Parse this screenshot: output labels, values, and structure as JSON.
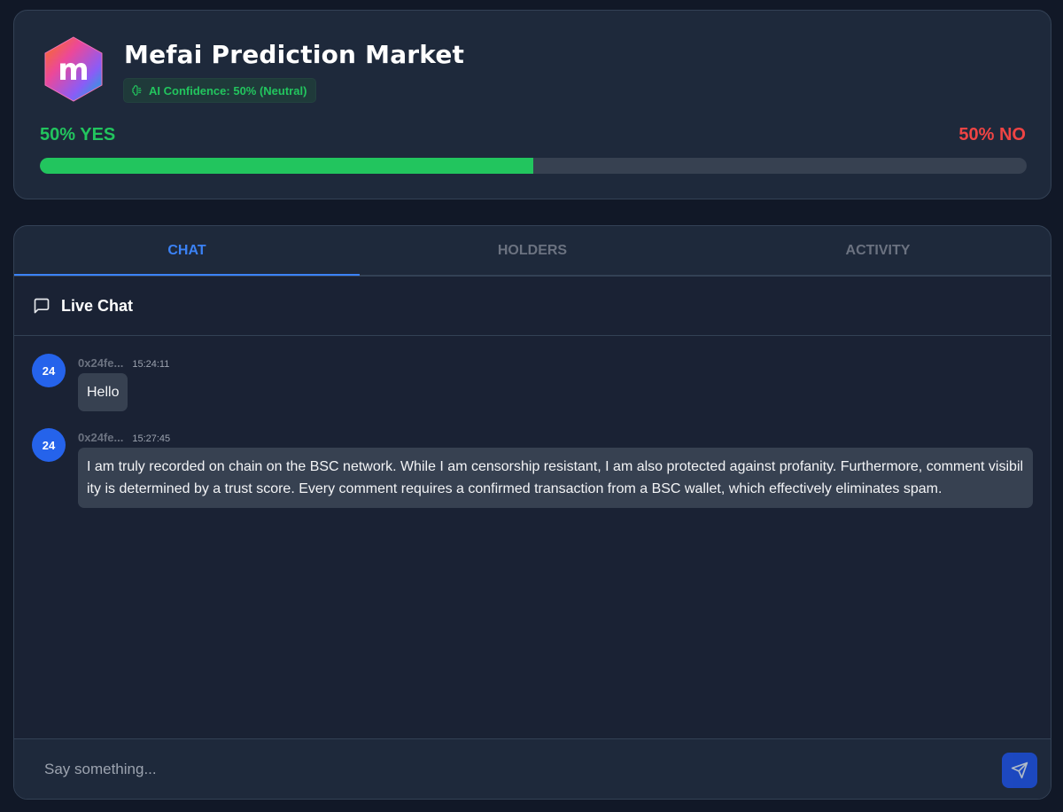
{
  "market": {
    "title": "Mefai Prediction Market",
    "logo_letter": "m",
    "confidence": "AI Confidence: 50% (Neutral)",
    "yes_label": "50% YES",
    "no_label": "50% NO",
    "yes_fraction": 0.5,
    "colors": {
      "yes": "#22c55e",
      "no": "#ef4444",
      "accent": "#3b82f6"
    }
  },
  "tabs": [
    {
      "label": "CHAT",
      "active": true
    },
    {
      "label": "HOLDERS",
      "active": false
    },
    {
      "label": "ACTIVITY",
      "active": false
    }
  ],
  "chat": {
    "header_icon": "message-square-icon",
    "title": "Live Chat",
    "messages": [
      {
        "avatar": "24",
        "author": "0x24fe...",
        "time": "15:24:11",
        "text": "Hello"
      },
      {
        "avatar": "24",
        "author": "0x24fe...",
        "time": "15:27:45",
        "text": "I am truly recorded on chain on the BSC network. While I am censorship resistant, I am also protected against profanity. Furthermore, comment visibility is determined by a trust score. Every comment requires a confirmed transaction from a BSC wallet, which effectively eliminates spam."
      }
    ],
    "input_placeholder": "Say something...",
    "input_value": "",
    "send_icon": "send-icon"
  }
}
